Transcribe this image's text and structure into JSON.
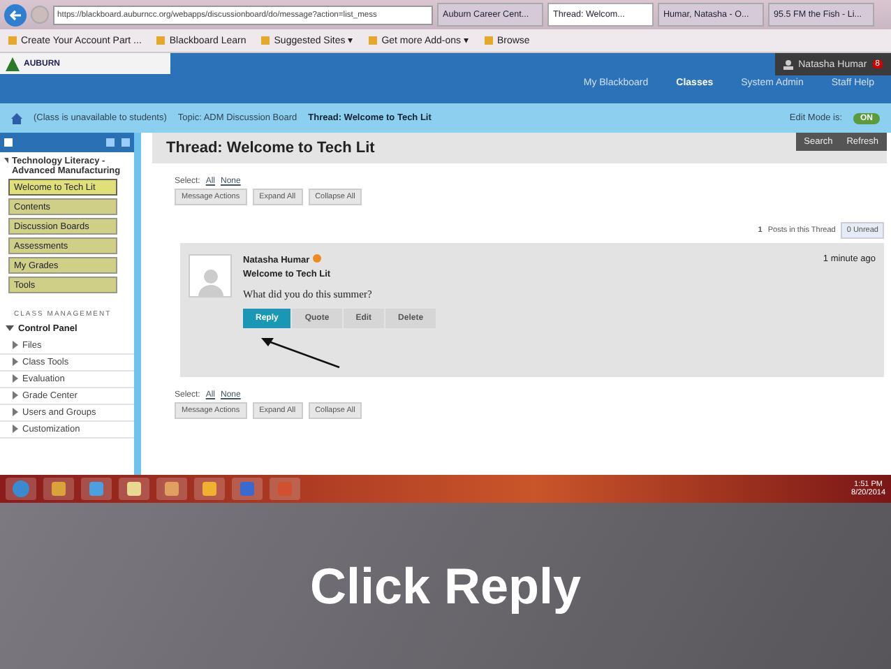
{
  "browser": {
    "address": "https://blackboard.auburncc.org/webapps/discussionboard/do/message?action=list_mess",
    "tabs": [
      {
        "label": "Auburn Career Cent...",
        "selected": false
      },
      {
        "label": "Thread: Welcom...",
        "selected": true
      },
      {
        "label": "Humar, Natasha - O...",
        "selected": false
      },
      {
        "label": "95.5 FM the Fish - Li...",
        "selected": false
      }
    ],
    "favorites": [
      "Create Your Account Part ...",
      "Blackboard Learn",
      "Suggested Sites ▾",
      "Get more Add-ons ▾",
      "Browse"
    ]
  },
  "header": {
    "logo": "AUBURN",
    "user": "Natasha Humar",
    "badge": "8",
    "nav": [
      {
        "label": "My Blackboard",
        "selected": false
      },
      {
        "label": "Classes",
        "selected": true
      },
      {
        "label": "System Admin",
        "selected": false
      },
      {
        "label": "Staff Help",
        "selected": false
      }
    ]
  },
  "breadcrumb": {
    "items": [
      "(Class is unavailable to students)",
      "Topic: ADM Discussion Board",
      "Thread: Welcome to Tech Lit"
    ],
    "edit_mode_label": "Edit Mode is:",
    "edit_mode": {
      "on": true,
      "label": "ON"
    }
  },
  "sidebar": {
    "course_title": "Technology Literacy - Advanced Manufacturing",
    "menu": [
      {
        "label": "Welcome to Tech Lit",
        "selected": true
      },
      {
        "label": "Contents",
        "selected": false
      },
      {
        "label": "Discussion Boards",
        "selected": false
      },
      {
        "label": "Assessments",
        "selected": false
      },
      {
        "label": "My Grades",
        "selected": false
      },
      {
        "label": "Tools",
        "selected": false
      }
    ],
    "section_label": "CLASS MANAGEMENT",
    "control_panel": {
      "label": "Control Panel",
      "expanded": true
    },
    "tools": [
      "Files",
      "Class Tools",
      "Evaluation",
      "Grade Center",
      "Users and Groups",
      "Customization"
    ]
  },
  "content": {
    "title": "Thread: Welcome to Tech Lit",
    "search": "Search",
    "refresh": "Refresh",
    "select_label": "Select:",
    "select_all": "All",
    "select_none": "None",
    "actions": [
      "Message Actions",
      "Expand All",
      "Collapse All"
    ],
    "posts_count": "1",
    "posts_label": "Posts in this Thread",
    "unread": "0 Unread",
    "post": {
      "author": "Natasha Humar",
      "subject": "Welcome to Tech Lit",
      "body": "What did you do this summer?",
      "time": "1 minute ago",
      "buttons": [
        {
          "label": "Reply",
          "primary": true
        },
        {
          "label": "Quote",
          "primary": false
        },
        {
          "label": "Edit",
          "primary": false
        },
        {
          "label": "Delete",
          "primary": false
        }
      ]
    },
    "bottom_select_label": "Select:",
    "bottom_select_all": "All",
    "bottom_select_none": "None",
    "bottom_actions": [
      "Message Actions",
      "Expand All",
      "Collapse All"
    ]
  },
  "taskbar": {
    "time": "1:51 PM",
    "date": "8/20/2014"
  },
  "caption": "Click Reply"
}
